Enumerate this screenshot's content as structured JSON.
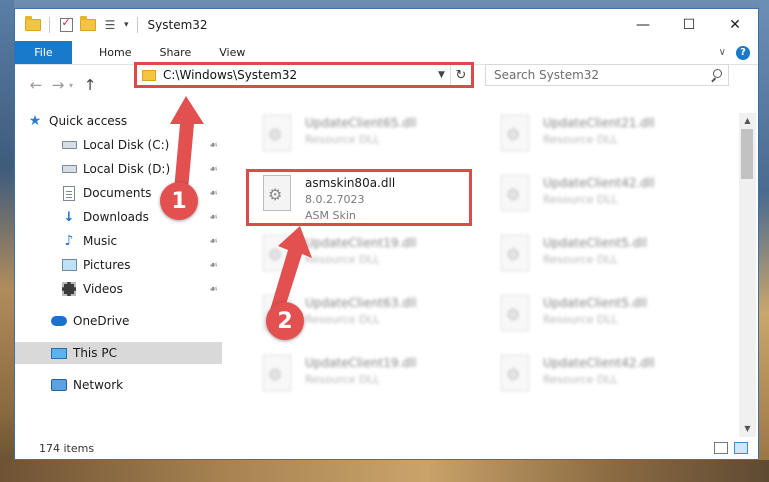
{
  "window": {
    "title": "System32"
  },
  "ribbon": {
    "tabs": [
      "File",
      "Home",
      "Share",
      "View"
    ]
  },
  "address": {
    "path": "C:\\Windows\\System32"
  },
  "search": {
    "placeholder": "Search System32"
  },
  "nav": {
    "items": [
      {
        "label": "Quick access",
        "icon": "star-icon",
        "pinned": false
      },
      {
        "label": "Local Disk (C:)",
        "icon": "drive-icon",
        "pinned": true
      },
      {
        "label": "Local Disk (D:)",
        "icon": "drive-icon",
        "pinned": true
      },
      {
        "label": "Documents",
        "icon": "documents-icon",
        "pinned": true
      },
      {
        "label": "Downloads",
        "icon": "downloads-icon",
        "pinned": true
      },
      {
        "label": "Music",
        "icon": "music-icon",
        "pinned": true
      },
      {
        "label": "Pictures",
        "icon": "pictures-icon",
        "pinned": true
      },
      {
        "label": "Videos",
        "icon": "videos-icon",
        "pinned": true
      },
      {
        "label": "OneDrive",
        "icon": "onedrive-icon",
        "pinned": false
      },
      {
        "label": "This PC",
        "icon": "this-pc-icon",
        "pinned": false,
        "selected": true
      },
      {
        "label": "Network",
        "icon": "network-icon",
        "pinned": false
      }
    ]
  },
  "files": {
    "highlighted": {
      "name": "asmskin80a.dll",
      "version": "8.0.2.7023",
      "description": "ASM Skin"
    },
    "left_column": [
      {
        "name": "UpdateClient65.dll",
        "type": "Resource DLL"
      },
      {
        "name": "UpdateClient19.dll",
        "type": "Resource DLL"
      },
      {
        "name": "UpdateClient63.dll",
        "type": "Resource DLL"
      },
      {
        "name": "UpdateClient19.dll",
        "type": "Resource DLL"
      }
    ],
    "right_column": [
      {
        "name": "UpdateClient21.dll",
        "type": "Resource DLL"
      },
      {
        "name": "UpdateClient42.dll",
        "type": "Resource DLL"
      },
      {
        "name": "UpdateClient5.dll",
        "type": "Resource DLL"
      },
      {
        "name": "UpdateClient5.dll",
        "type": "Resource DLL"
      },
      {
        "name": "UpdateClient42.dll",
        "type": "Resource DLL"
      }
    ]
  },
  "status": {
    "item_count": "174 items"
  },
  "annotations": {
    "callout_1": "1",
    "callout_2": "2",
    "color": "#e25050"
  }
}
